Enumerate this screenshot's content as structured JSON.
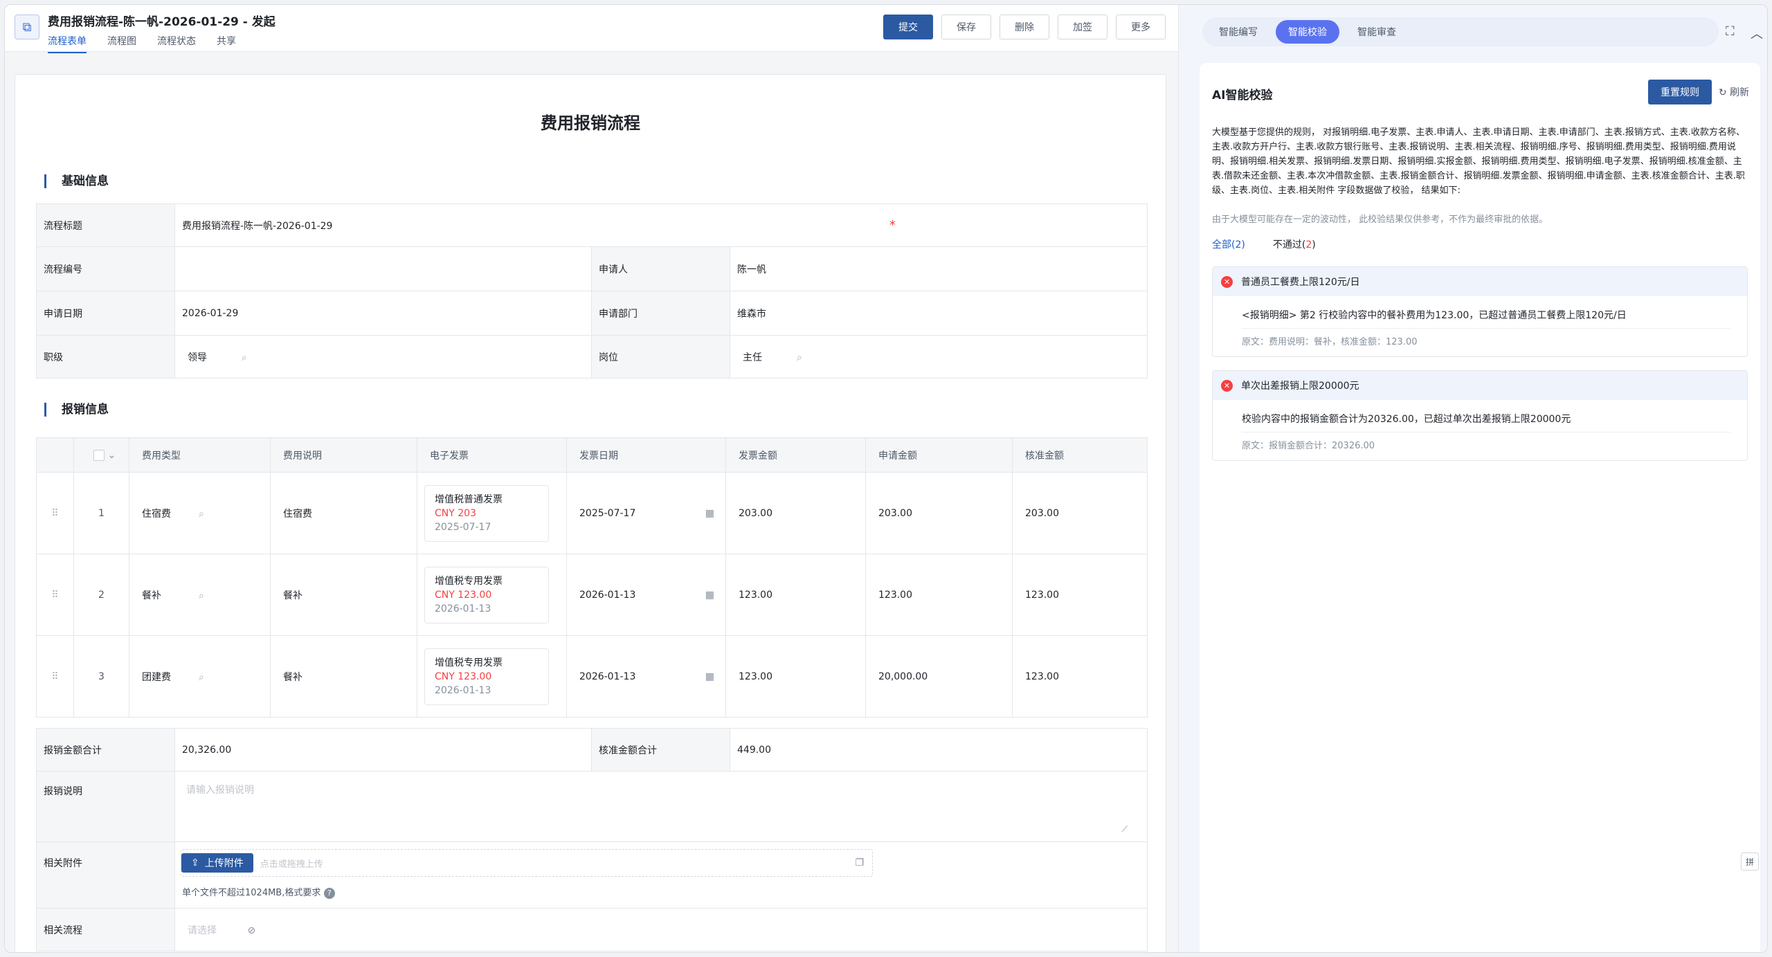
{
  "header": {
    "title": "费用报销流程-陈一帆-2026-01-29 - 发起",
    "tabs": [
      "流程表单",
      "流程图",
      "流程状态",
      "共享"
    ],
    "actions": {
      "submit": "提交",
      "save": "保存",
      "delete": "删除",
      "add_sign": "加签",
      "more": "更多"
    }
  },
  "form": {
    "title": "费用报销流程",
    "basic_section": "基础信息",
    "fields": {
      "flow_title_label": "流程标题",
      "flow_title_value": "费用报销流程-陈一帆-2026-01-29",
      "flow_no_label": "流程编号",
      "flow_no_value": "",
      "applicant_label": "申请人",
      "applicant_value": "陈一帆",
      "apply_date_label": "申请日期",
      "apply_date_value": "2026-01-29",
      "dept_label": "申请部门",
      "dept_value": "维森市",
      "rank_label": "职级",
      "rank_value": "领导",
      "post_label": "岗位",
      "post_value": "主任"
    },
    "detail_section": "报销信息",
    "detail_headers": [
      "费用类型",
      "费用说明",
      "电子发票",
      "发票日期",
      "发票金额",
      "申请金额",
      "核准金额"
    ],
    "rows": [
      {
        "idx": "1",
        "type": "住宿费",
        "desc": "住宿费",
        "inv_name": "增值税普通发票",
        "inv_amount": "CNY  203",
        "inv_date": "2025-07-17",
        "date": "2025-07-17",
        "inv_total": "203.00",
        "apply": "203.00",
        "approved": "203.00"
      },
      {
        "idx": "2",
        "type": "餐补",
        "desc": "餐补",
        "inv_name": "增值税专用发票",
        "inv_amount": "CNY  123.00",
        "inv_date": "2026-01-13",
        "date": "2026-01-13",
        "inv_total": "123.00",
        "apply": "123.00",
        "approved": "123.00"
      },
      {
        "idx": "3",
        "type": "团建费",
        "desc": "餐补",
        "inv_name": "增值税专用发票",
        "inv_amount": "CNY  123.00",
        "inv_date": "2026-01-13",
        "date": "2026-01-13",
        "inv_total": "123.00",
        "apply": "20,000.00",
        "approved": "123.00"
      }
    ],
    "totals": {
      "sum_label": "报销金额合计",
      "sum_value": "20,326.00",
      "approved_label": "核准金额合计",
      "approved_value": "449.00",
      "note_label": "报销说明",
      "note_placeholder": "请输入报销说明",
      "attach_label": "相关附件",
      "upload_label": "上传附件",
      "upload_placeholder": "点击或拖拽上传",
      "upload_hint": "单个文件不超过1024MB,格式要求",
      "related_label": "相关流程",
      "related_placeholder": "请选择"
    }
  },
  "ai": {
    "tabs": [
      "智能编写",
      "智能校验",
      "智能审查"
    ],
    "title": "AI智能校验",
    "reset": "重置规则",
    "refresh": "刷新",
    "description": "大模型基于您提供的规则， 对报销明细.电子发票、主表.申请人、主表.申请日期、主表.申请部门、主表.报销方式、主表.收款方名称、主表.收款方开户行、主表.收款方银行账号、主表.报销说明、主表.相关流程、报销明细.序号、报销明细.费用类型、报销明细.费用说明、报销明细.相关发票、报销明细.发票日期、报销明细.实报金额、报销明细.费用类型、报销明细.电子发票、报销明细.核准金额、主表.借款未还金额、主表.本次冲借款金额、主表.报销金额合计、报销明细.发票金额、报销明细.申请金额、主表.核准金额合计、主表.职级、主表.岗位、主表.相关附件 字段数据做了校验， 结果如下:",
    "note": "由于大模型可能存在一定的波动性， 此校验结果仅供参考，不作为最终审批的依据。",
    "filter_all": "全部(2)",
    "filter_fail_prefix": "不通过(",
    "filter_fail_count": "2",
    "filter_fail_suffix": ")",
    "results": [
      {
        "title": "普通员工餐费上限120元/日",
        "message": "<报销明细> 第2 行校验内容中的餐补费用为123.00，已超过普通员工餐费上限120元/日",
        "source": "原文：费用说明：餐补，核准金额：123.00"
      },
      {
        "title": "单次出差报销上限20000元",
        "message": "校验内容中的报销金额合计为20326.00，已超过单次出差报销上限20000元",
        "source": "原文：报销金额合计：20326.00"
      }
    ],
    "side_kb": "拼"
  },
  "colors": {
    "primary": "#2b5aa3",
    "accent": "#5a72f0",
    "error": "#f53f3f",
    "link": "#1d5fc6"
  }
}
